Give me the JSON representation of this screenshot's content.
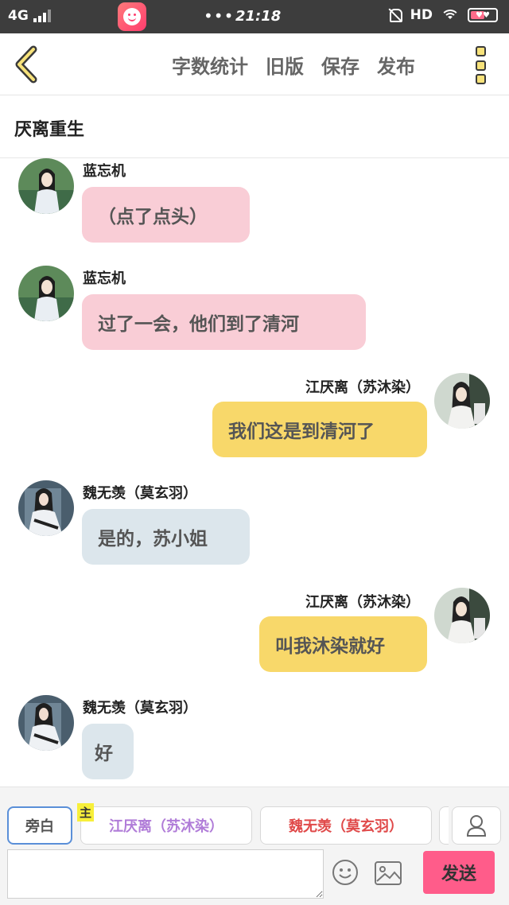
{
  "status_bar": {
    "network": "4G",
    "time": "21:18",
    "dots": "•••",
    "hd": "HD",
    "battery_color": "#ff6b8a",
    "battery_level": 0.55
  },
  "toolbar": {
    "back_icon": "chevron-left-icon",
    "actions": [
      "字数统计",
      "旧版",
      "保存",
      "发布"
    ],
    "menu_icon": "vertical-dots-icon"
  },
  "title": "厌离重生",
  "messages": [
    {
      "side": "left",
      "name": "蓝忘机",
      "text": "（点了点头）",
      "bubble_color": "#f9cdd6",
      "avatar": "lanwangji"
    },
    {
      "side": "left",
      "name": "蓝忘机",
      "text": "过了一会，他们到了清河",
      "bubble_color": "#f9cdd6",
      "avatar": "lanwangji"
    },
    {
      "side": "right",
      "name": "江厌离（苏沐染）",
      "text": "我们这是到清河了",
      "bubble_color": "#f8d86a",
      "avatar": "jiangyanli"
    },
    {
      "side": "left",
      "name": "魏无羡（莫玄羽）",
      "text": "是的，苏小姐",
      "bubble_color": "#dce6ec",
      "avatar": "weiwuxian"
    },
    {
      "side": "right",
      "name": "江厌离（苏沐染）",
      "text": "叫我沐染就好",
      "bubble_color": "#f8d86a",
      "avatar": "jiangyanli"
    },
    {
      "side": "left",
      "name": "魏无羡（莫玄羽）",
      "text": "好",
      "bubble_color": "#dce6ec",
      "avatar": "weiwuxian"
    }
  ],
  "roles": {
    "narration": "旁白",
    "main_tag": "主",
    "role_a": "江厌离（苏沐染）",
    "role_b": "魏无羡（莫玄羽）",
    "role_a_color": "#b07cd8",
    "role_b_color": "#e04a4a"
  },
  "input": {
    "value": "",
    "placeholder": "",
    "send_label": "发送",
    "send_color": "#ff5c8a"
  }
}
